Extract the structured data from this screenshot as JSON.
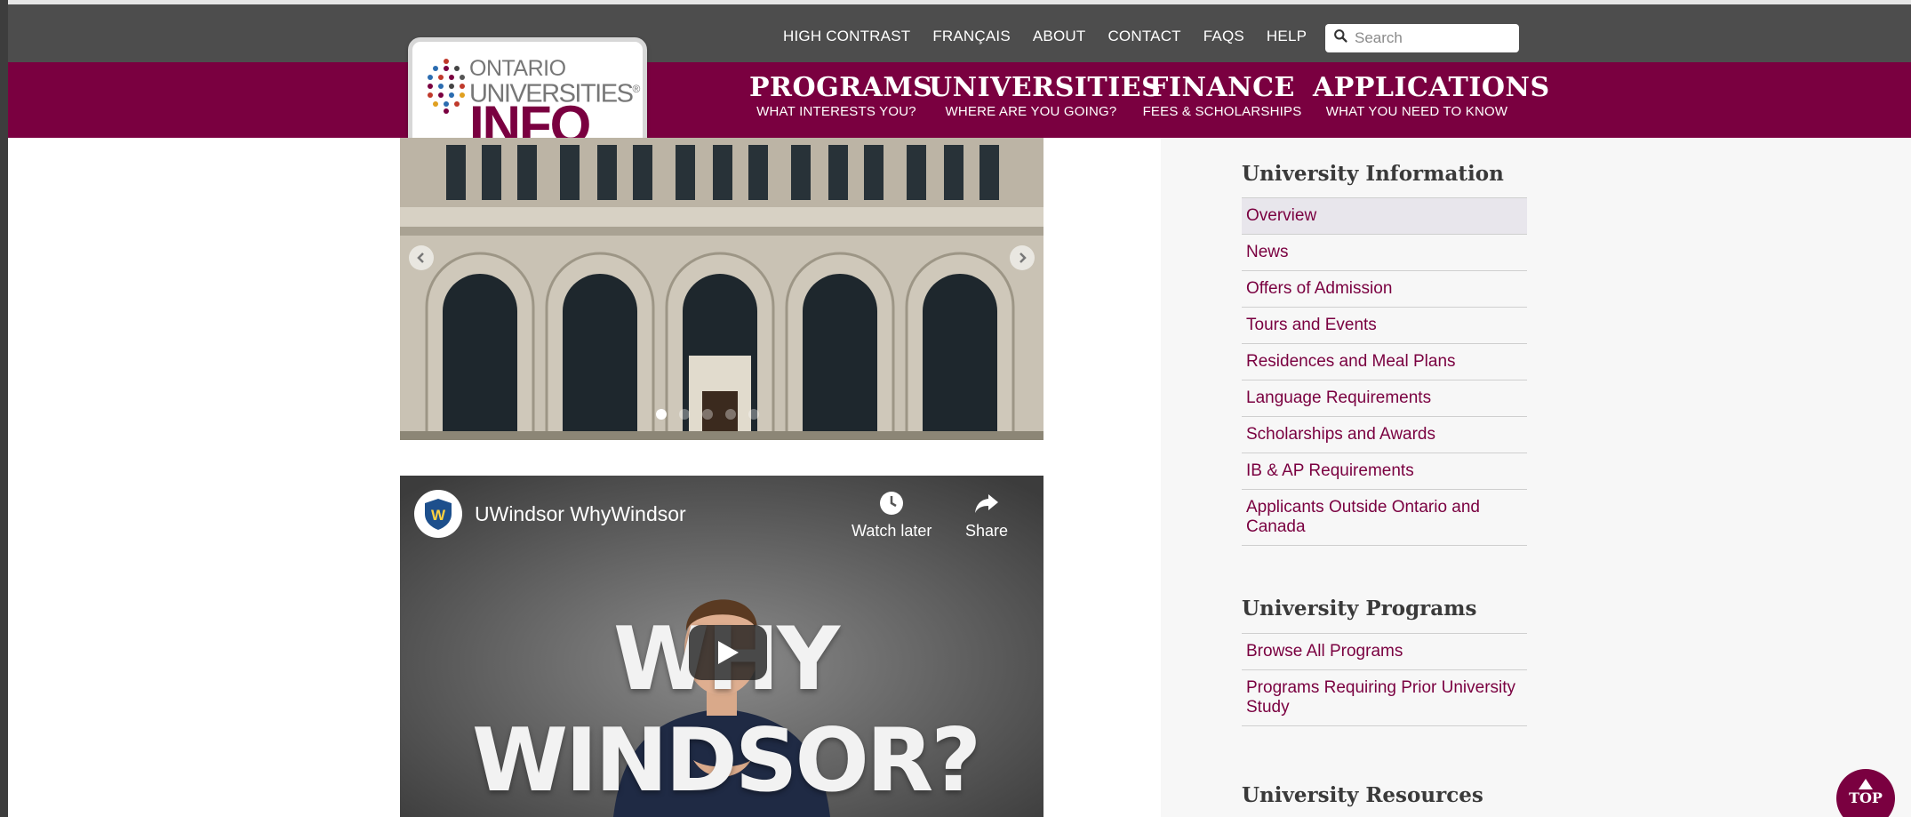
{
  "utility_nav": {
    "links": [
      "HIGH CONTRAST",
      "FRANÇAIS",
      "ABOUT",
      "CONTACT",
      "FAQS",
      "HELP"
    ],
    "search_placeholder": "Search"
  },
  "logo": {
    "line1": "ONTARIO",
    "line2": "UNIVERSITIES",
    "line3": "INFO",
    "trademark": "®"
  },
  "main_nav": [
    {
      "title": "PROGRAMS",
      "subtitle": "WHAT INTERESTS YOU?"
    },
    {
      "title": "UNIVERSITIES",
      "subtitle": "WHERE ARE YOU GOING?"
    },
    {
      "title": "FINANCE",
      "subtitle": "FEES & SCHOLARSHIPS"
    },
    {
      "title": "APPLICATIONS",
      "subtitle": "WHAT YOU NEED TO KNOW"
    }
  ],
  "carousel": {
    "active_slide": 1,
    "slide_count": 5
  },
  "video": {
    "title": "UWindsor WhyWindsor",
    "watch_later_label": "Watch later",
    "share_label": "Share",
    "overlay_text": "WHY WINDSOR?"
  },
  "sidebar": {
    "university_information": {
      "heading": "University Information",
      "items": [
        "Overview",
        "News",
        "Offers of Admission",
        "Tours and Events",
        "Residences and Meal Plans",
        "Language Requirements",
        "Scholarships and Awards",
        "IB & AP Requirements",
        "Applicants Outside Ontario and Canada"
      ]
    },
    "university_programs": {
      "heading": "University Programs",
      "items": [
        "Browse All Programs",
        "Programs Requiring Prior University Study"
      ]
    },
    "university_resources": {
      "heading": "University Resources"
    }
  },
  "top_button": {
    "label": "TOP"
  },
  "colors": {
    "brand": "#7a0040",
    "utility_bar": "#4d4d4d"
  }
}
